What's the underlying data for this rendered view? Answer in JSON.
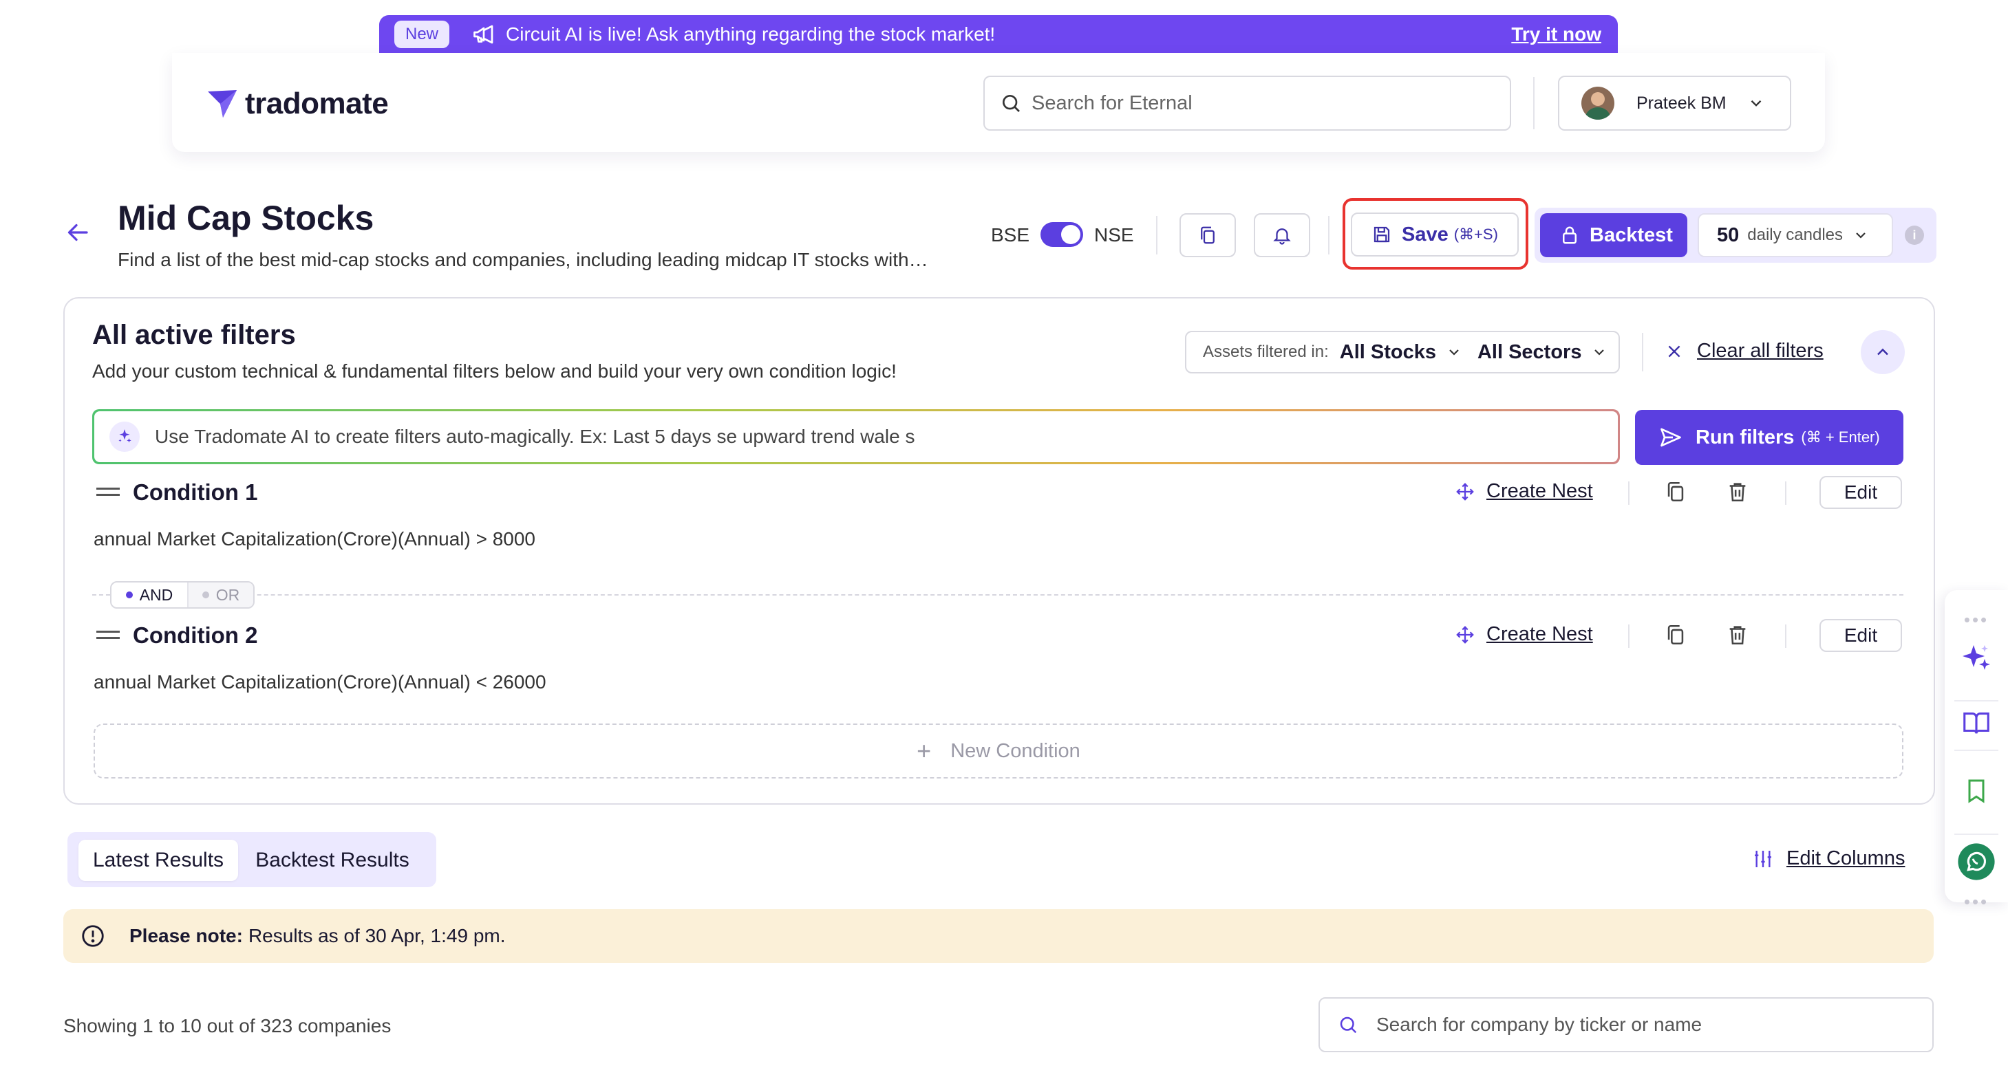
{
  "banner": {
    "badge": "New",
    "message": "Circuit AI is live! Ask anything regarding the stock market!",
    "cta": "Try it now"
  },
  "header": {
    "logo_text": "tradomate",
    "search_placeholder": "Search for Eternal",
    "user_name": "Prateek BM"
  },
  "screen": {
    "title": "Mid Cap Stocks",
    "description": "Find a list of the best mid-cap stocks and companies, including leading midcap IT stocks with…",
    "exchange_left": "BSE",
    "exchange_right": "NSE",
    "exchange_selected": "NSE",
    "save_label": "Save",
    "save_shortcut": "(⌘+S)",
    "backtest_label": "Backtest",
    "candles_count": "50",
    "candles_unit": "daily candles",
    "info": "i"
  },
  "filters": {
    "title": "All active filters",
    "subtitle": "Add your custom technical & fundamental filters below and build your very own condition logic!",
    "assets_label": "Assets filtered in:",
    "assets_value": "All Stocks",
    "sectors_value": "All Sectors",
    "clear_all": "Clear all filters",
    "ai_placeholder": "Use Tradomate AI to create filters auto-magically. Ex: Last 5 days se upward trend wale s",
    "run_label": "Run filters",
    "run_shortcut": "(⌘ + Enter)",
    "conditions": [
      {
        "title": "Condition 1",
        "expression": "annual Market Capitalization(Crore)(Annual) > 8000",
        "nest_label": "Create Nest",
        "edit_label": "Edit"
      },
      {
        "title": "Condition 2",
        "expression": "annual Market Capitalization(Crore)(Annual) < 26000",
        "nest_label": "Create Nest",
        "edit_label": "Edit"
      }
    ],
    "logic_and": "AND",
    "logic_or": "OR",
    "new_condition": "New Condition"
  },
  "results": {
    "tabs": [
      {
        "label": "Latest Results",
        "active": true
      },
      {
        "label": "Backtest Results",
        "active": false
      }
    ],
    "edit_columns": "Edit Columns",
    "note_lead": "Please note:",
    "note_text": "Results as of 30 Apr, 1:49 pm.",
    "showing": "Showing 1 to 10 out of 323 companies",
    "search_placeholder": "Search for company by ticker or name"
  },
  "colors": {
    "accent": "#5b3fe0",
    "banner": "#6e47f0",
    "highlight_ring": "#e8332f",
    "note_bg": "#fbf0d8",
    "whatsapp": "#1f8a5b"
  }
}
